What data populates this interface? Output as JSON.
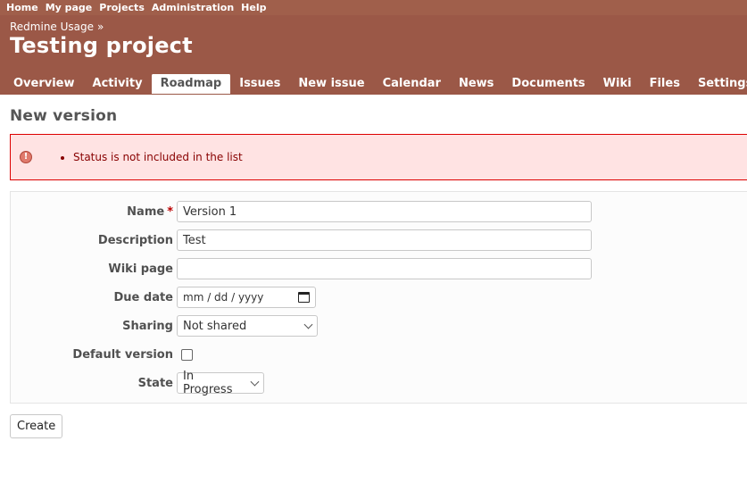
{
  "top_menu": {
    "items": [
      "Home",
      "My page",
      "Projects",
      "Administration",
      "Help"
    ]
  },
  "header": {
    "breadcrumb": "Redmine Usage",
    "breadcrumb_sep": "»",
    "project_title": "Testing project"
  },
  "main_menu": {
    "tabs": [
      {
        "label": "Overview",
        "selected": false
      },
      {
        "label": "Activity",
        "selected": false
      },
      {
        "label": "Roadmap",
        "selected": true
      },
      {
        "label": "Issues",
        "selected": false
      },
      {
        "label": "New issue",
        "selected": false
      },
      {
        "label": "Calendar",
        "selected": false
      },
      {
        "label": "News",
        "selected": false
      },
      {
        "label": "Documents",
        "selected": false
      },
      {
        "label": "Wiki",
        "selected": false
      },
      {
        "label": "Files",
        "selected": false
      },
      {
        "label": "Settings",
        "selected": false
      }
    ]
  },
  "page": {
    "heading": "New version"
  },
  "error": {
    "icon": "error-icon",
    "messages": [
      "Status is not included in the list"
    ]
  },
  "form": {
    "name": {
      "label": "Name",
      "required_mark": "*",
      "value": "Version 1"
    },
    "description": {
      "label": "Description",
      "value": "Test"
    },
    "wiki_page": {
      "label": "Wiki page",
      "value": ""
    },
    "due_date": {
      "label": "Due date",
      "placeholder": "mm / dd / yyyy"
    },
    "sharing": {
      "label": "Sharing",
      "selected": "Not shared"
    },
    "default_version": {
      "label": "Default version",
      "checked": false
    },
    "state": {
      "label": "State",
      "selected": "In Progress"
    }
  },
  "actions": {
    "create_label": "Create"
  },
  "colors": {
    "header_bg": "#9b5847",
    "top_menu_bg": "#a05f4b",
    "error_bg": "#ffe3e3",
    "error_text": "#880000",
    "required": "#bb0000"
  }
}
